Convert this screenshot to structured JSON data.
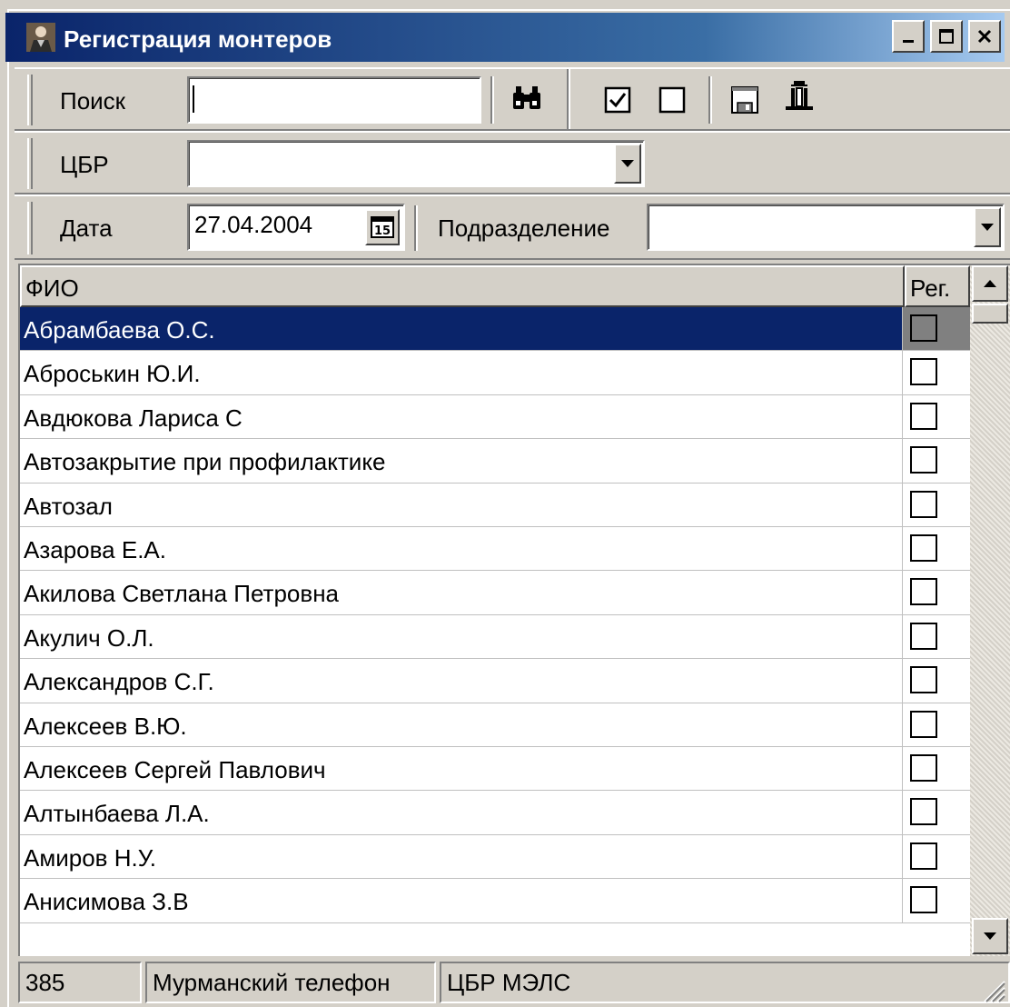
{
  "window": {
    "title": "Регистрация монтеров",
    "controls": {
      "minimize": "_",
      "maximize": "□",
      "close": "×"
    }
  },
  "toolbar": {
    "search": {
      "label": "Поиск",
      "value": ""
    },
    "find_icon": "binoculars-icon",
    "check_all_icon": "checkbox-checked-icon",
    "uncheck_all_icon": "checkbox-empty-icon",
    "save_icon": "save-icon",
    "exit_icon": "exit-door-icon"
  },
  "cbr": {
    "label": "ЦБР",
    "value": ""
  },
  "date": {
    "label": "Дата",
    "value": "27.04.2004",
    "calendar_text": "15"
  },
  "subdivision": {
    "label": "Подразделение",
    "value": ""
  },
  "grid": {
    "columns": [
      "ФИО",
      "Рег."
    ],
    "selected_index": 0,
    "rows": [
      {
        "name": "Абрамбаева О.С.",
        "reg": false
      },
      {
        "name": "Аброськин Ю.И.",
        "reg": false
      },
      {
        "name": "Авдюкова Лариса С",
        "reg": false
      },
      {
        "name": "Автозакрытие при профилактике",
        "reg": false
      },
      {
        "name": "Автозал",
        "reg": false
      },
      {
        "name": "Азарова Е.А.",
        "reg": false
      },
      {
        "name": "Акилова Светлана Петровна",
        "reg": false
      },
      {
        "name": "Акулич О.Л.",
        "reg": false
      },
      {
        "name": "Александров С.Г.",
        "reg": false
      },
      {
        "name": "Алексеев В.Ю.",
        "reg": false
      },
      {
        "name": "Алексеев Сергей Павлович",
        "reg": false
      },
      {
        "name": "Алтынбаева Л.А.",
        "reg": false
      },
      {
        "name": "Амиров Н.У.",
        "reg": false
      },
      {
        "name": "Анисимова З.В",
        "reg": false
      }
    ]
  },
  "status": {
    "code": "385",
    "org": "Мурманский телефон",
    "cbr": "ЦБР МЭЛС"
  },
  "colors": {
    "title_bar": "#0a246a",
    "selection": "#0a246a",
    "face": "#d4d0c8"
  }
}
